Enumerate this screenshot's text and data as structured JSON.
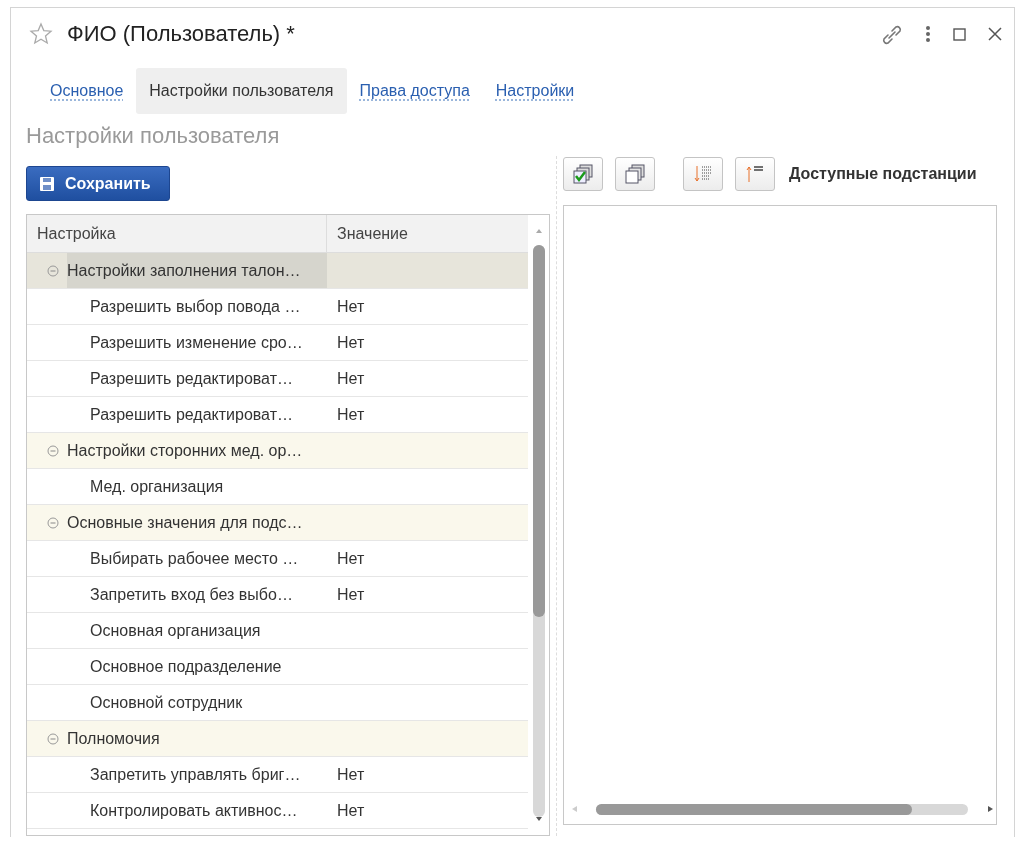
{
  "window": {
    "title": "ФИО (Пользователь) *"
  },
  "tabs": [
    {
      "label": "Основное",
      "selected": false
    },
    {
      "label": "Настройки пользователя",
      "selected": true
    },
    {
      "label": "Права доступа",
      "selected": false
    },
    {
      "label": "Настройки",
      "selected": false
    }
  ],
  "section_title": "Настройки пользователя",
  "save_button": "Сохранить",
  "settings_table": {
    "columns": [
      "Настройка",
      "Значение"
    ],
    "rows": [
      {
        "setting": "Настройки заполнения талон…",
        "expanded": true,
        "selected": true,
        "children": [
          {
            "setting": "Разрешить выбор повода …",
            "value": "Нет",
            "selected": false
          },
          {
            "setting": "Разрешить изменение сро…",
            "value": "Нет",
            "selected": false
          },
          {
            "setting": "Разрешить редактироват…",
            "value": "Нет",
            "selected": false
          },
          {
            "setting": "Разрешить редактироват…",
            "value": "Нет",
            "selected": false
          }
        ]
      },
      {
        "setting": "Настройки сторонних мед. ор…",
        "expanded": true,
        "selected": false,
        "children": [
          {
            "setting": "Мед. организация",
            "selected": false
          }
        ]
      },
      {
        "setting": "Основные значения для подс…",
        "expanded": true,
        "selected": false,
        "children": [
          {
            "setting": "Выбирать рабочее место …",
            "value": "Нет",
            "selected": false
          },
          {
            "setting": "Запретить вход без выбо…",
            "value": "Нет",
            "selected": false
          },
          {
            "setting": "Основная организация",
            "selected": false
          },
          {
            "setting": "Основное подразделение",
            "selected": false
          },
          {
            "setting": "Основной сотрудник",
            "selected": false
          }
        ]
      },
      {
        "setting": "Полномочия",
        "expanded": true,
        "selected": false,
        "children": [
          {
            "setting": "Запретить управлять бриг…",
            "value": "Нет",
            "selected": false
          },
          {
            "setting": "Контролировать активнос…",
            "value": "Нет",
            "selected": false
          }
        ]
      }
    ]
  },
  "substations": {
    "title": "Доступные подстанции"
  }
}
